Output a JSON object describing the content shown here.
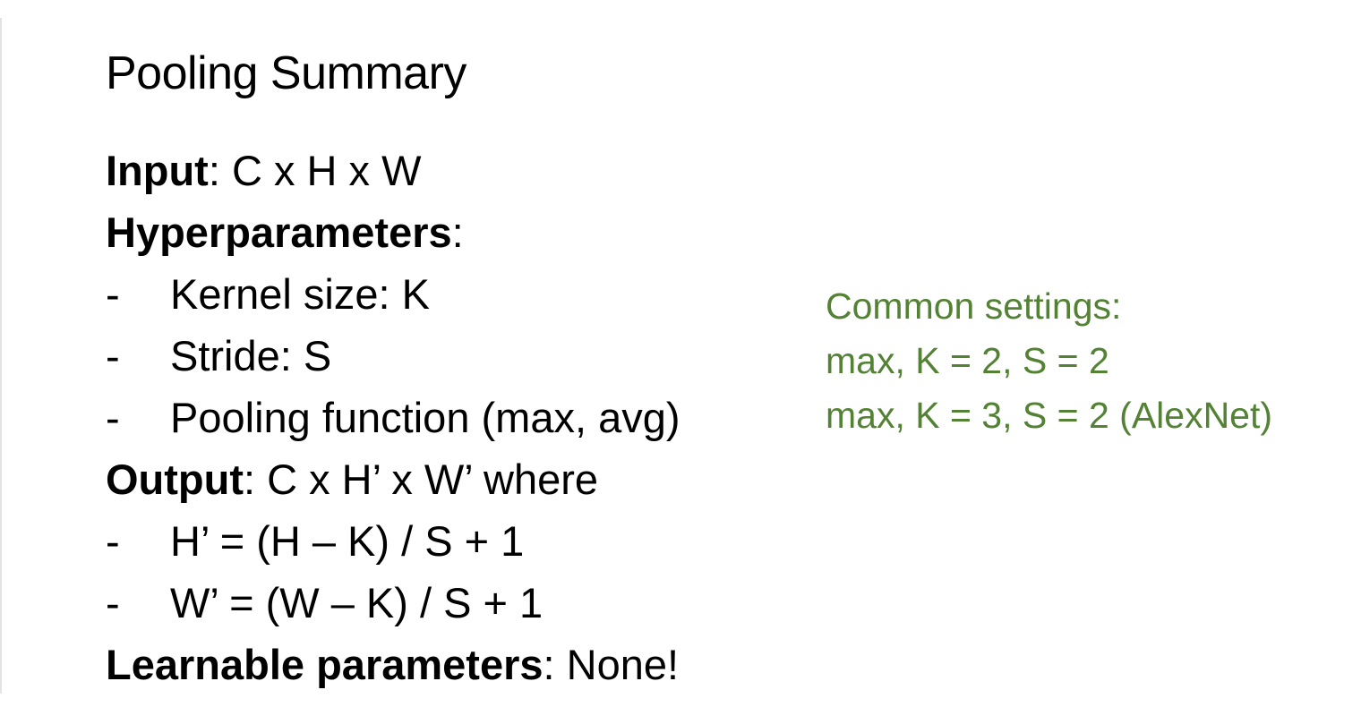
{
  "slide": {
    "title": "Pooling Summary",
    "input_label": "Input",
    "input_value": ": C x H x W",
    "hyper_label": "Hyperparameters",
    "hyper_value": ":",
    "hyper_items": [
      "Kernel size: K",
      "Stride: S",
      "Pooling function (max, avg)"
    ],
    "output_label": "Output",
    "output_value": ": C x H’ x W’ where",
    "output_items": [
      "H’ = (H – K) / S + 1",
      "W’ = (W – K) / S + 1"
    ],
    "learnable_label": "Learnable parameters",
    "learnable_value": ": None!",
    "bullet": "-"
  },
  "side_note": {
    "color": "#548235",
    "heading": "Common settings:",
    "lines": [
      "max, K = 2, S = 2",
      "max, K = 3, S = 2 (AlexNet)"
    ]
  }
}
